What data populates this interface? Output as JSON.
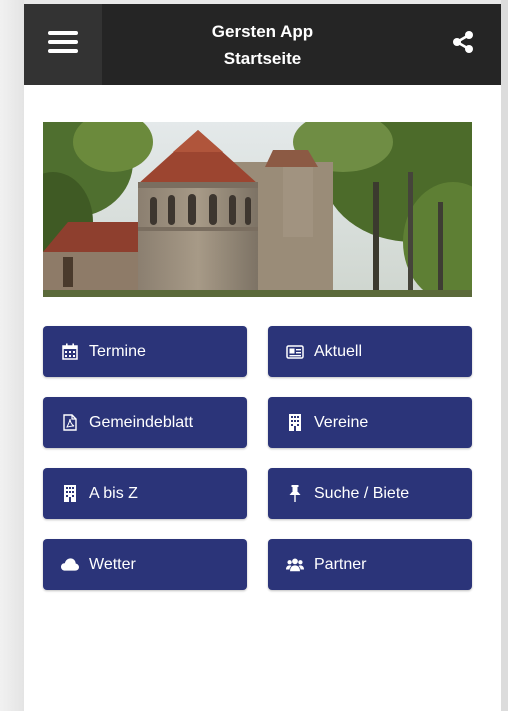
{
  "header": {
    "title_line1": "Gersten App",
    "title_line2": "Startseite",
    "menu_icon": "hamburger-menu-icon",
    "share_icon": "share-icon"
  },
  "hero": {
    "alt": "Kirche"
  },
  "colors": {
    "header_bg": "#252525",
    "button_bg": "#2b3479",
    "button_text": "#ffffff"
  },
  "buttons": [
    {
      "label": "Termine",
      "icon": "calendar-icon"
    },
    {
      "label": "Aktuell",
      "icon": "newspaper-icon"
    },
    {
      "label": "Gemeindeblatt",
      "icon": "pdf-file-icon"
    },
    {
      "label": "Vereine",
      "icon": "building-icon"
    },
    {
      "label": "A bis Z",
      "icon": "building-icon"
    },
    {
      "label": "Suche / Biete",
      "icon": "pin-icon"
    },
    {
      "label": "Wetter",
      "icon": "cloud-icon"
    },
    {
      "label": "Partner",
      "icon": "users-icon"
    }
  ]
}
